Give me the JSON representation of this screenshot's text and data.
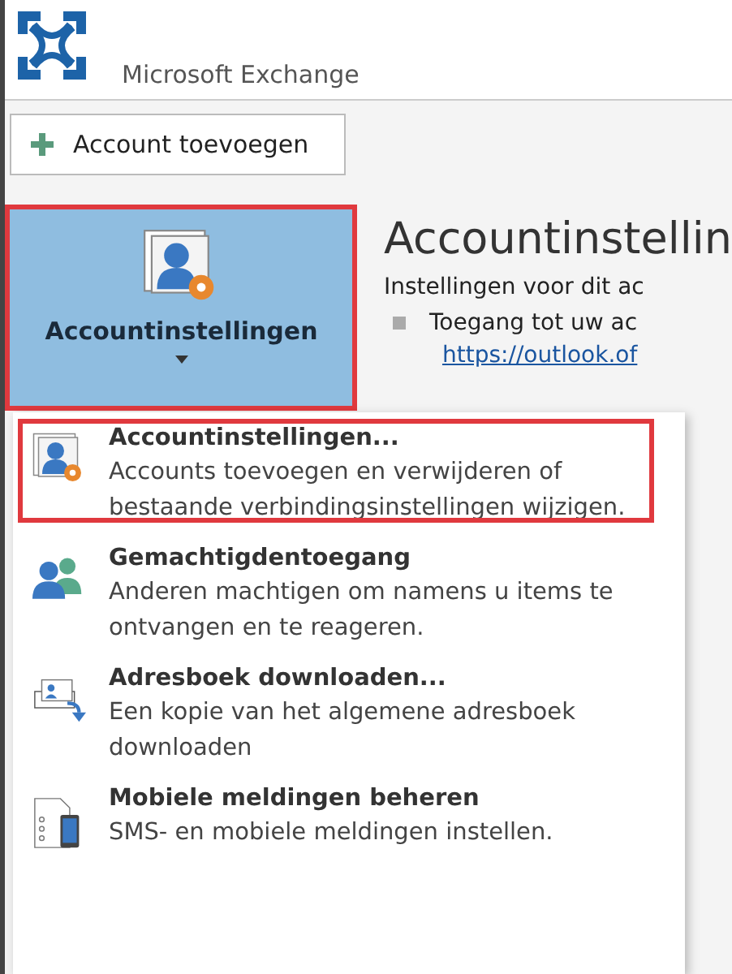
{
  "header": {
    "title": "Microsoft Exchange"
  },
  "add_account": {
    "label": "Account toevoegen"
  },
  "settings_button": {
    "label": "Accountinstellingen",
    "highlighted": true
  },
  "info": {
    "heading": "Accountinstellin",
    "subtitle": "Instellingen voor dit ac",
    "bullet": "Toegang tot uw ac",
    "link": "https://outlook.of"
  },
  "menu": [
    {
      "kind": "settings",
      "title": "Accountinstellingen...",
      "description": "Accounts toevoegen en verwijderen of bestaande verbindingsinstellingen wijzigen.",
      "highlighted": true
    },
    {
      "kind": "delegate",
      "title": "Gemachtigdentoegang",
      "description": "Anderen machtigen om namens u items te ontvangen en te reageren.",
      "highlighted": false
    },
    {
      "kind": "addressbook",
      "title": "Adresboek downloaden...",
      "description": "Een kopie van het algemene adresboek downloaden",
      "highlighted": false
    },
    {
      "kind": "mobile",
      "title": "Mobiele meldingen beheren",
      "description": "SMS- en mobiele meldingen instellen.",
      "highlighted": false
    }
  ]
}
